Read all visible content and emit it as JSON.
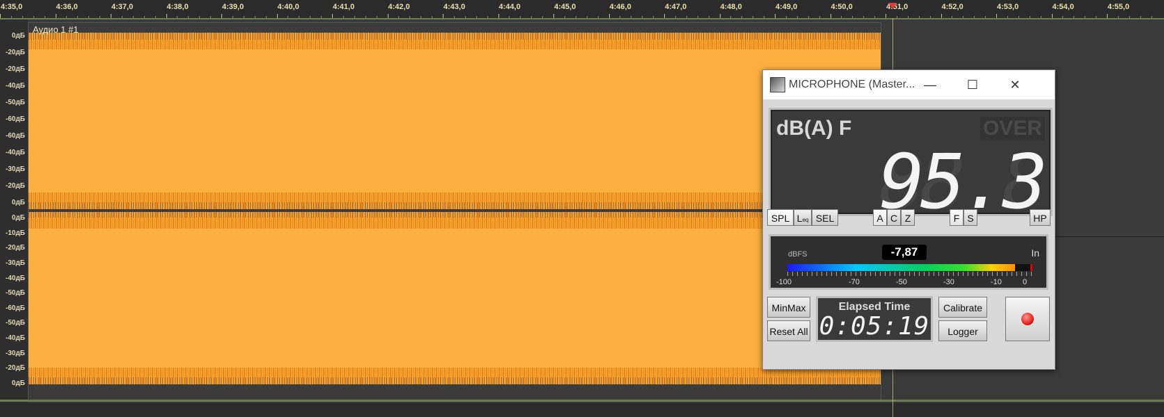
{
  "ruler": {
    "labels": [
      "4:35,0",
      "4:36,0",
      "4:37,0",
      "4:38,0",
      "4:39,0",
      "4:40,0",
      "4:41,0",
      "4:42,0",
      "4:43,0",
      "4:44,0",
      "4:45,0",
      "4:46,0",
      "4:47,0",
      "4:48,0",
      "4:49,0",
      "4:50,0",
      "4:51,0",
      "4:52,0",
      "4:53,0",
      "4:54,0",
      "4:55,0"
    ]
  },
  "db_scale": {
    "channel1": [
      "0дБ",
      "-20дБ",
      "-20дБ",
      "-40дБ",
      "-50дБ",
      "-60дБ",
      "-60дБ",
      "-40дБ",
      "-30дБ",
      "-20дБ",
      "0дБ"
    ],
    "channel2": [
      "0дБ",
      "-10дБ",
      "-20дБ",
      "-30дБ",
      "-40дБ",
      "-50дБ",
      "-60дБ",
      "-50дБ",
      "-40дБ",
      "-30дБ",
      "-20дБ",
      "0дБ"
    ]
  },
  "clip": {
    "title": "Аудио 1 #1"
  },
  "meter": {
    "window_title": "MICROPHONE (Master...",
    "minimize": "—",
    "maximize": "☐",
    "close": "✕",
    "mode": "dB(A) F",
    "over": "OVER",
    "ghost_digits": "88.8",
    "reading": "95.3",
    "buttons": {
      "spl": "SPL",
      "leq": "L",
      "leq_sub": "eq",
      "sel": "SEL",
      "a": "A",
      "c": "C",
      "z": "Z",
      "f": "F",
      "s": "S",
      "hp": "HP"
    },
    "level": {
      "dbfs_label": "dBFS",
      "dbfs_value": "-7,87",
      "in_label": "In",
      "fill_fraction": 0.93,
      "scale": [
        "-100",
        "-70",
        "-50",
        "-30",
        "-10",
        "0"
      ]
    },
    "minmax": "MinMax",
    "reset_all": "Reset All",
    "elapsed_title": "Elapsed Time",
    "elapsed_value": "0:05:19",
    "calibrate": "Calibrate",
    "logger": "Logger"
  }
}
